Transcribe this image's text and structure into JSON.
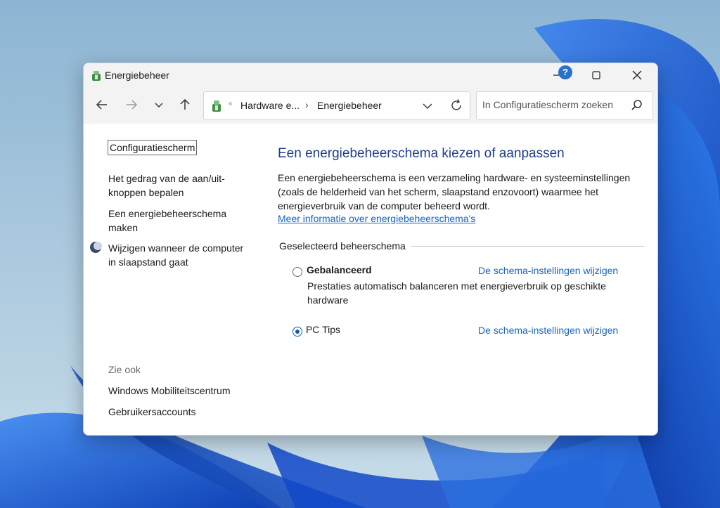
{
  "window": {
    "title": "Energiebeheer",
    "controls": {
      "minimize": "minimize-icon",
      "maximize": "maximize-icon",
      "close": "close-icon"
    }
  },
  "nav": {
    "icons": [
      "back-arrow-icon",
      "forward-arrow-icon",
      "recent-locations-chevron-icon",
      "up-arrow-icon"
    ]
  },
  "address": {
    "overflow": "«",
    "crumbs": [
      "Hardware e...",
      "Energiebeheer"
    ],
    "separator": "›"
  },
  "search": {
    "placeholder": "In Configuratiescherm zoeken"
  },
  "help": {
    "label": "?"
  },
  "sidebar": {
    "home": "Configuratiescherm",
    "links": [
      "Het gedrag van de aan/uit-knoppen bepalen",
      "Een energiebeheerschema maken",
      "Wijzigen wanneer de computer in slaapstand gaat"
    ],
    "see_also_label": "Zie ook",
    "see_also": [
      "Windows Mobiliteitscentrum",
      "Gebruikersaccounts"
    ]
  },
  "main": {
    "title": "Een energiebeheerschema kiezen of aanpassen",
    "description": "Een energiebeheerschema is een verzameling hardware- en systeeminstellingen (zoals de helderheid van het scherm, slaapstand enzovoort) waarmee het energieverbruik van de computer beheerd wordt.",
    "more_link": "Meer informatie over energiebeheerschema's",
    "group_label": "Geselecteerd beheerschema",
    "plans": [
      {
        "name": "Gebalanceerd",
        "selected": false,
        "description": "Prestaties automatisch balanceren met energieverbruik op geschikte hardware",
        "link": "De schema-instellingen wijzigen"
      },
      {
        "name": "PC Tips",
        "selected": true,
        "description": "",
        "link": "De schema-instellingen wijzigen"
      }
    ]
  },
  "colors": {
    "accent": "#1565c0",
    "title_blue": "#1e3e8c",
    "desktop_blue": "#1a63d8"
  }
}
